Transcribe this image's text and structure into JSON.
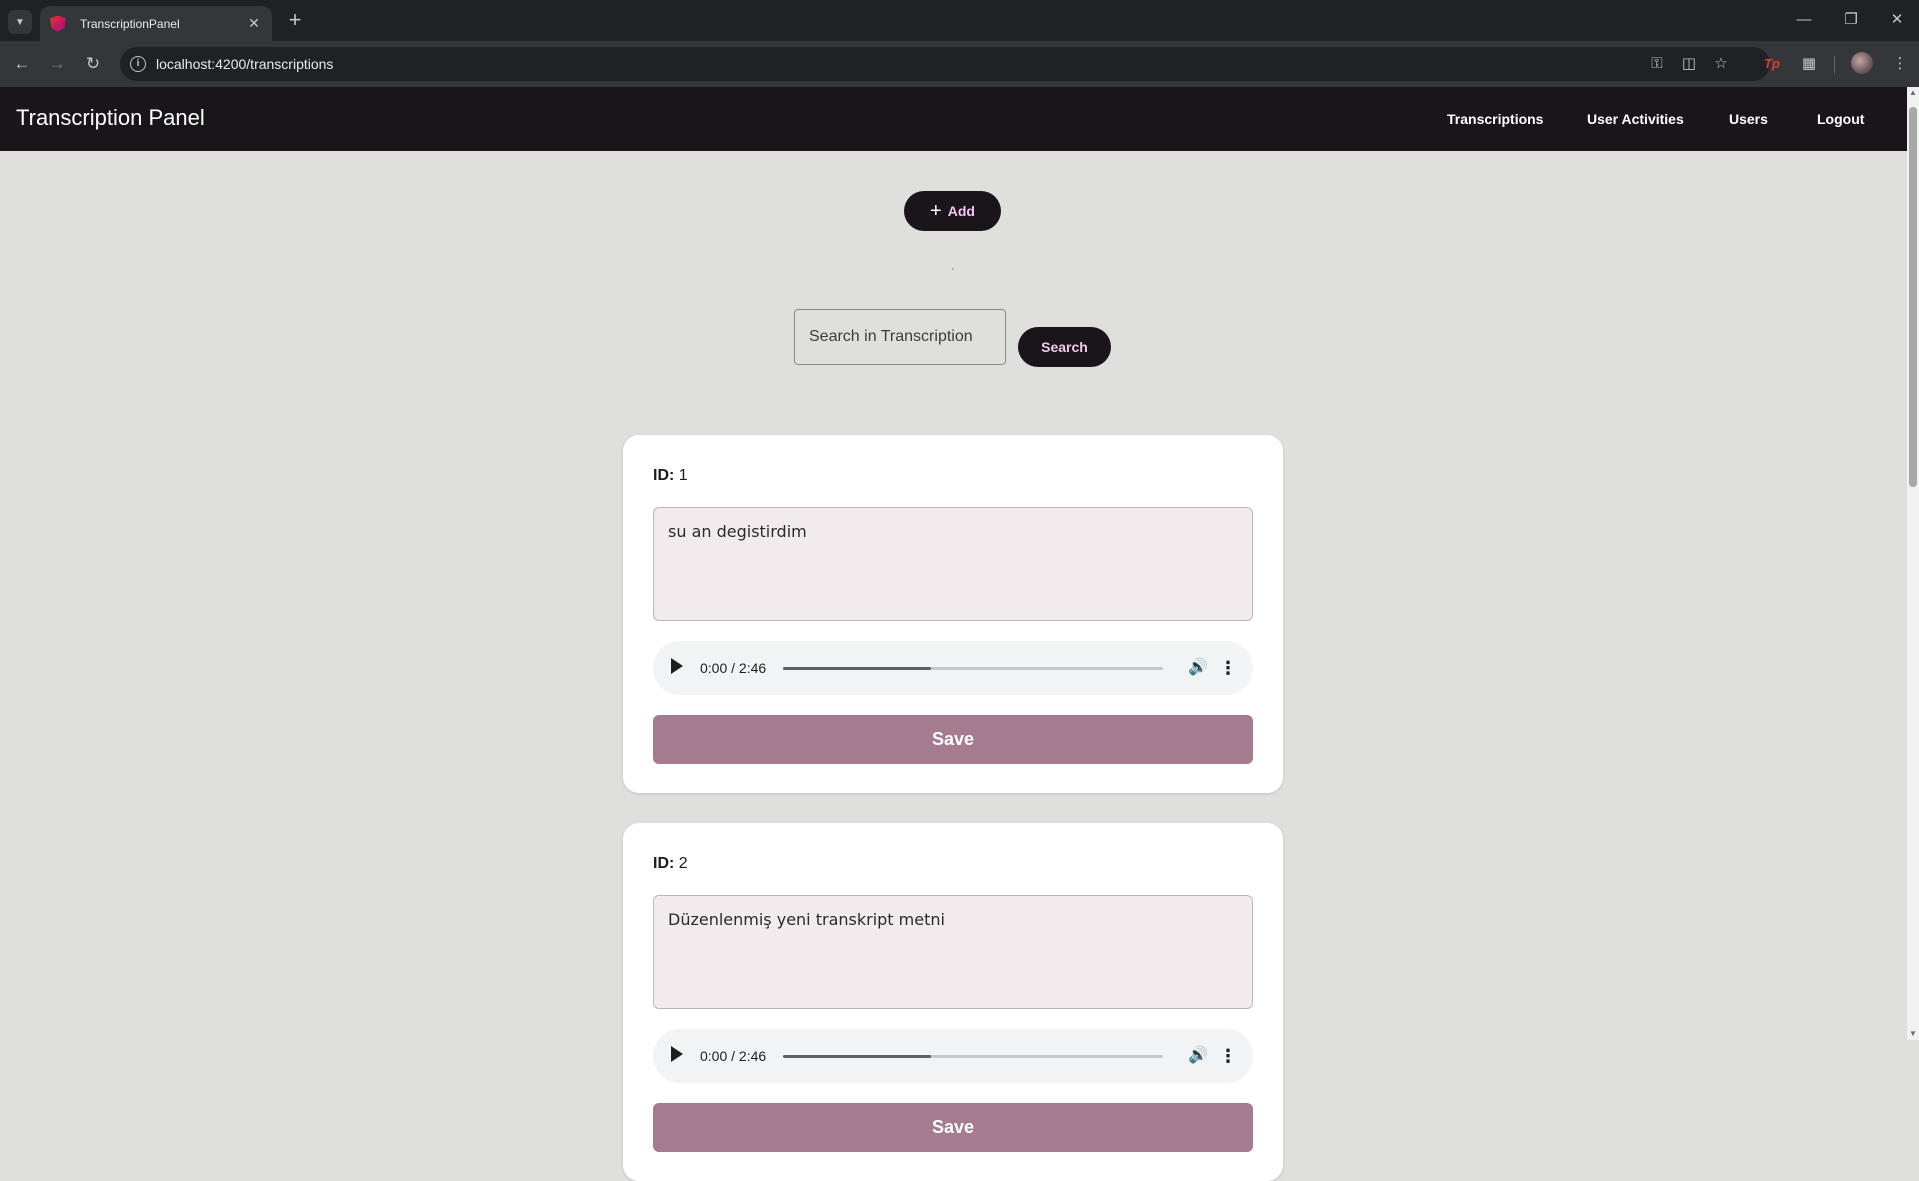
{
  "browser": {
    "tab_title": "TranscriptionPanel",
    "tab_close": "✕",
    "new_tab": "+",
    "url": "localhost:4200/transcriptions",
    "ext_tp": "Tp"
  },
  "header": {
    "title": "Transcription Panel",
    "nav": [
      "Transcriptions",
      "User Activities",
      "Users",
      "Logout"
    ]
  },
  "toolbar": {
    "add_label": "Add",
    "search_placeholder": "Search in Transcription",
    "search_label": "Search"
  },
  "transcriptions": [
    {
      "id_label": "ID:",
      "id": "1",
      "text": "su an degistirdim",
      "audio_time": "0:00 / 2:46",
      "audio_buffered": 0.39,
      "save_label": "Save"
    },
    {
      "id_label": "ID:",
      "id": "2",
      "text": "Düzenlenmiş yeni transkript metni",
      "audio_time": "0:00 / 2:46",
      "audio_buffered": 0.39,
      "save_label": "Save"
    }
  ],
  "colors": {
    "header_bg": "#19151a",
    "page_bg": "#dfdfde",
    "accent_text": "#f5c6f0",
    "save_button": "#a57b90",
    "textarea_bg": "#f1ebee"
  }
}
